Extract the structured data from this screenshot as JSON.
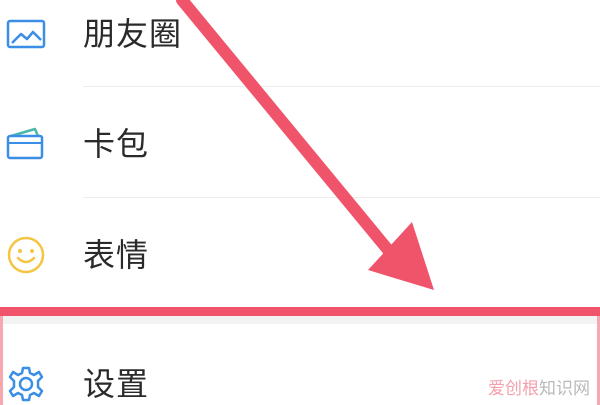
{
  "menu": {
    "items": [
      {
        "id": "moments",
        "label": "朋友圈",
        "icon": "image-landscape-icon"
      },
      {
        "id": "card-package",
        "label": "卡包",
        "icon": "card-wallet-icon"
      },
      {
        "id": "stickers",
        "label": "表情",
        "icon": "smiley-face-icon"
      },
      {
        "id": "settings",
        "label": "设置",
        "icon": "gear-icon"
      }
    ]
  },
  "colors": {
    "icon_blue": "#3a8ee6",
    "icon_yellow": "#f5c542",
    "annotation_red": "#f0546a"
  },
  "watermark": {
    "brand": "爱创根",
    "site": "知识网"
  }
}
